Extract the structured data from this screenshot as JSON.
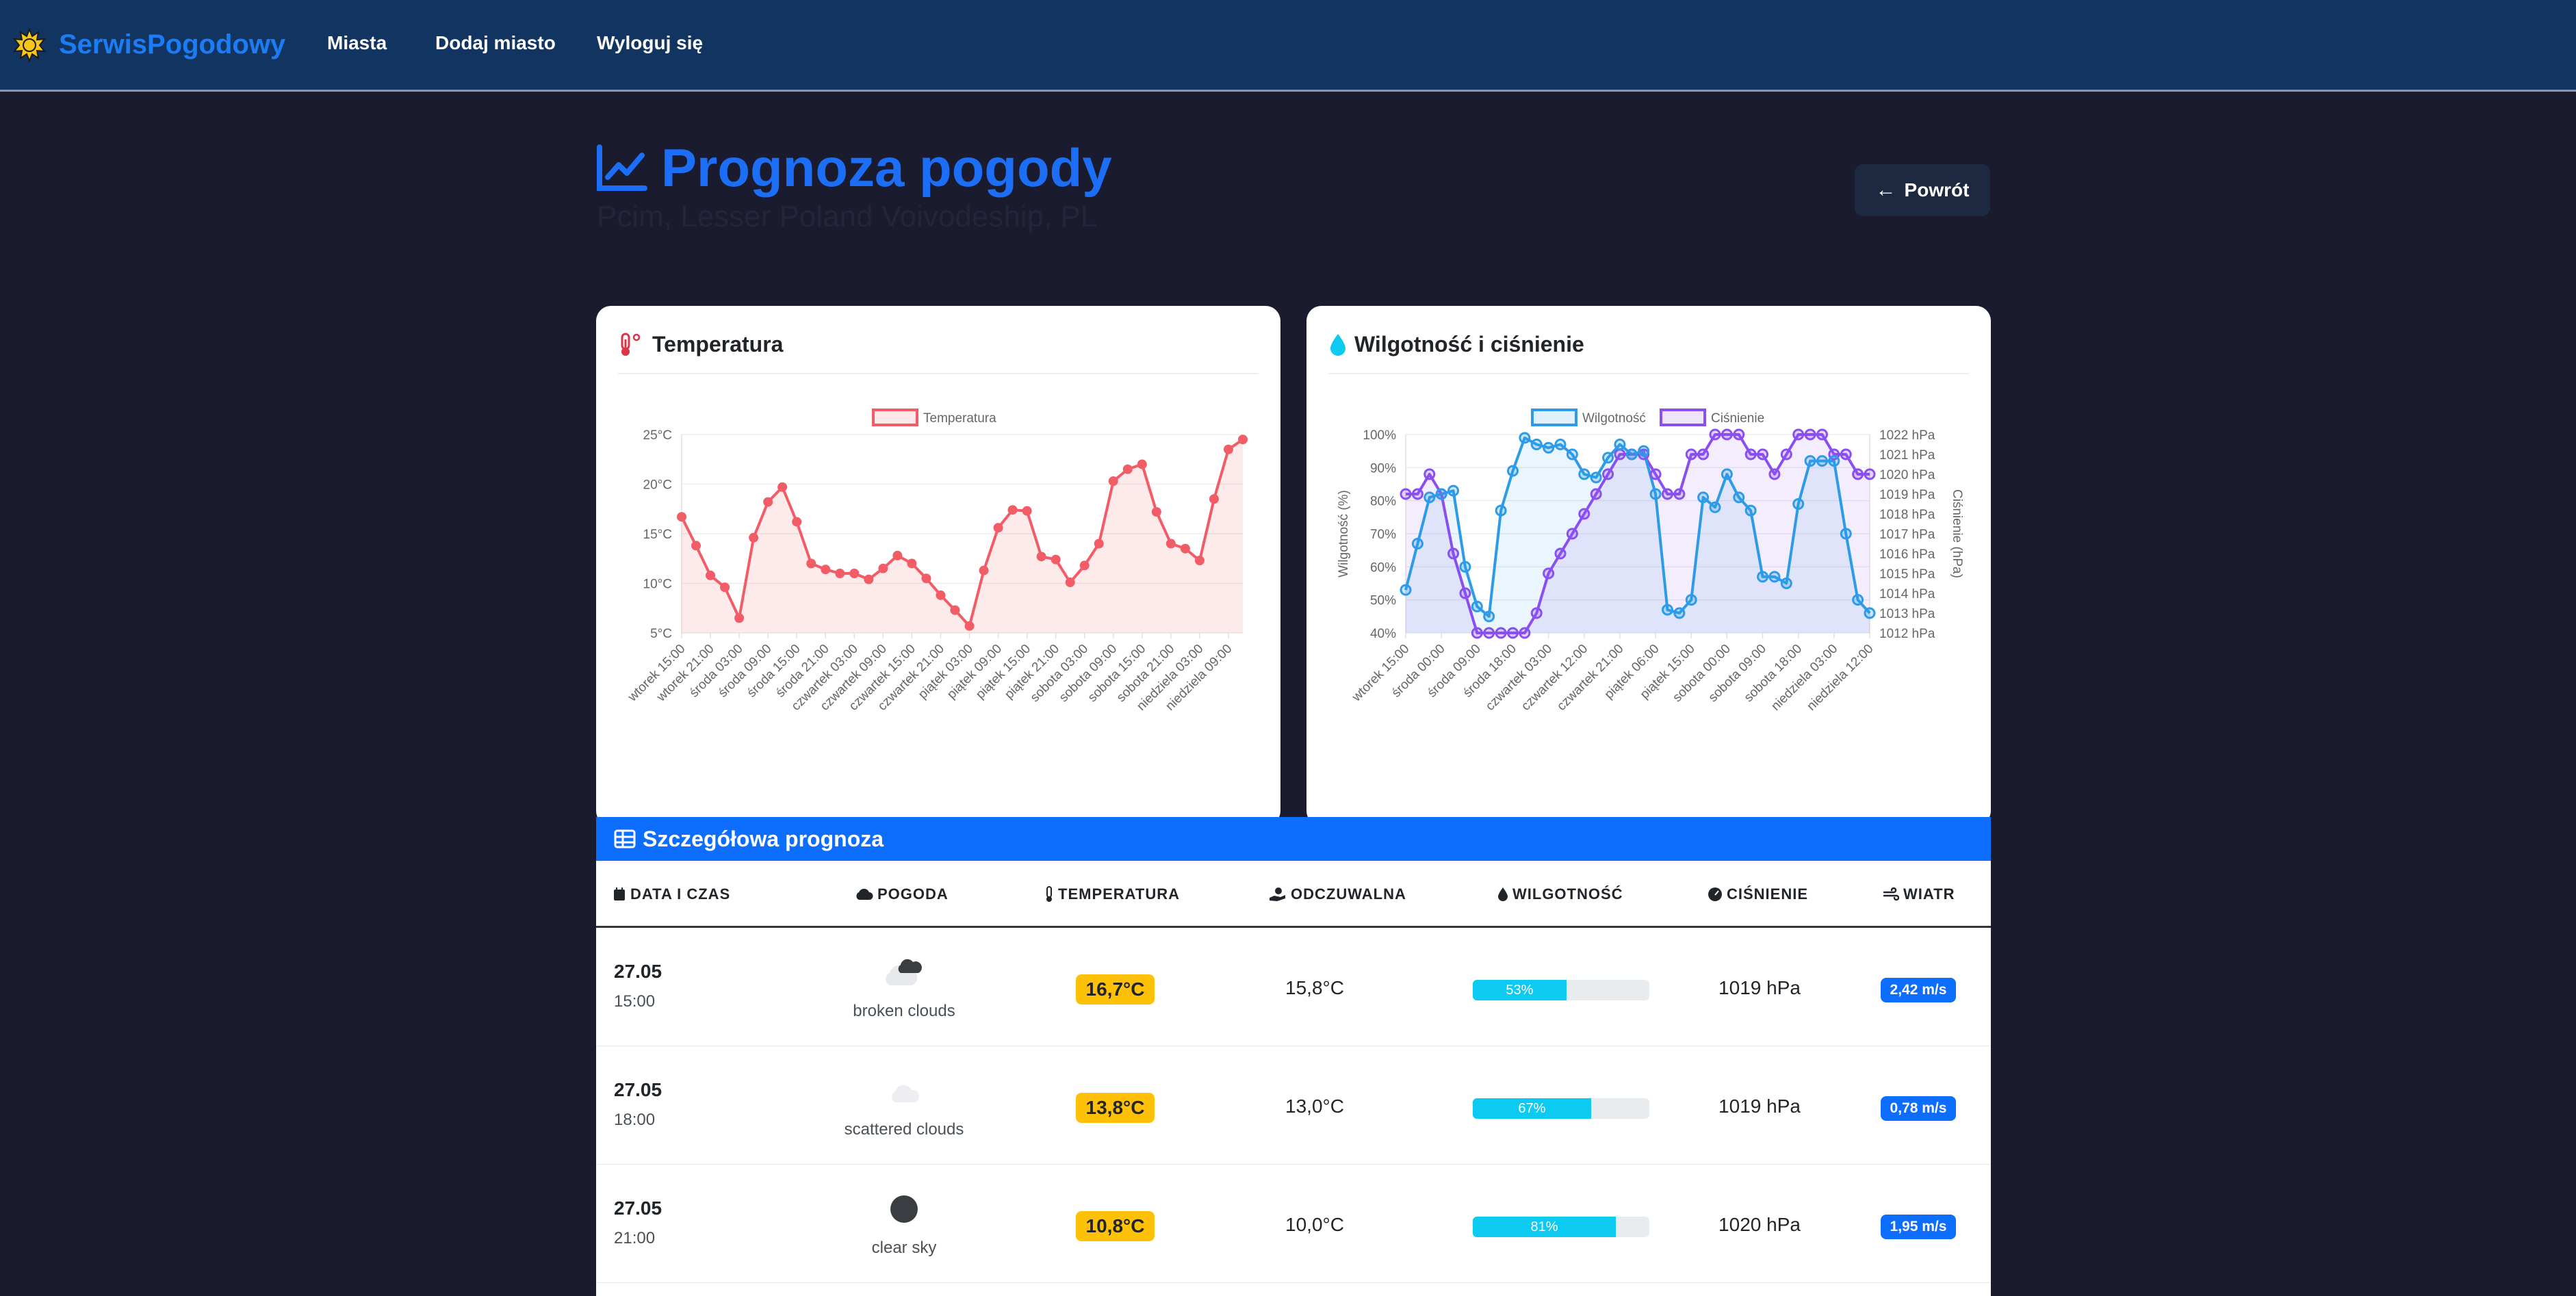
{
  "navbar": {
    "brand": "SerwisPogodowy",
    "links": [
      "Miasta",
      "Dodaj miasto",
      "Wyloguj się"
    ]
  },
  "header": {
    "title": "Prognoza pogody",
    "subtitle": "Pcim, Lesser Poland Voivodeship, PL",
    "back_label": "Powrót"
  },
  "temperature_card": {
    "title": "Temperatura"
  },
  "humidity_card": {
    "title": "Wilgotność i ciśnienie"
  },
  "table": {
    "title": "Szczegółowa prognoza",
    "columns": [
      "DATA I CZAS",
      "POGODA",
      "TEMPERATURA",
      "ODCZUWALNA",
      "WILGOTNOŚĆ",
      "CIŚNIENIE",
      "WIATR"
    ],
    "rows": [
      {
        "date": "27.05",
        "time": "15:00",
        "weather": "broken clouds",
        "icon": "broken-clouds-icon",
        "temp": "16,7°C",
        "feels": "15,8°C",
        "humidity": 53,
        "humidity_label": "53%",
        "pressure": "1019 hPa",
        "wind": "2,42 m/s"
      },
      {
        "date": "27.05",
        "time": "18:00",
        "weather": "scattered clouds",
        "icon": "scattered-clouds-icon",
        "temp": "13,8°C",
        "feels": "13,0°C",
        "humidity": 67,
        "humidity_label": "67%",
        "pressure": "1019 hPa",
        "wind": "0,78 m/s"
      },
      {
        "date": "27.05",
        "time": "21:00",
        "weather": "clear sky",
        "icon": "clear-sky-icon",
        "temp": "10,8°C",
        "feels": "10,0°C",
        "humidity": 81,
        "humidity_label": "81%",
        "pressure": "1020 hPa",
        "wind": "1,95 m/s"
      }
    ]
  },
  "colors": {
    "navbar": "#123461",
    "brand": "#1b7cf5",
    "temp_line": "#f25c66",
    "humidity_line": "#2d9be8",
    "pressure_line": "#8a4ff0",
    "table_header": "#0d6efd",
    "temp_badge": "#ffc107"
  },
  "chart_data": [
    {
      "type": "line",
      "title": "",
      "x": [
        "wtorek 15:00",
        "wtorek 18:00",
        "wtorek 21:00",
        "środa 00:00",
        "środa 03:00",
        "środa 06:00",
        "środa 09:00",
        "środa 12:00",
        "środa 15:00",
        "środa 18:00",
        "środa 21:00",
        "czwartek 00:00",
        "czwartek 03:00",
        "czwartek 06:00",
        "czwartek 09:00",
        "czwartek 12:00",
        "czwartek 15:00",
        "czwartek 18:00",
        "czwartek 21:00",
        "piątek 00:00",
        "piątek 03:00",
        "piątek 06:00",
        "piątek 09:00",
        "piątek 12:00",
        "piątek 15:00",
        "piątek 18:00",
        "piątek 21:00",
        "sobota 00:00",
        "sobota 03:00",
        "sobota 06:00",
        "sobota 09:00",
        "sobota 12:00",
        "sobota 15:00",
        "sobota 18:00",
        "sobota 21:00",
        "niedziela 00:00",
        "niedziela 03:00",
        "niedziela 06:00",
        "niedziela 09:00",
        "niedziela 12:00"
      ],
      "tick_labels": [
        "wtorek 15:00",
        "wtorek 21:00",
        "środa 03:00",
        "środa 09:00",
        "środa 15:00",
        "środa 21:00",
        "czwartek 03:00",
        "czwartek 09:00",
        "czwartek 15:00",
        "czwartek 21:00",
        "piątek 03:00",
        "piątek 09:00",
        "piątek 15:00",
        "piątek 21:00",
        "sobota 03:00",
        "sobota 09:00",
        "sobota 15:00",
        "sobota 21:00",
        "niedziela 03:00",
        "niedziela 09:00"
      ],
      "series": [
        {
          "name": "Temperatura",
          "values": [
            16.7,
            13.8,
            10.8,
            9.6,
            6.5,
            14.6,
            18.2,
            19.7,
            16.2,
            12.0,
            11.4,
            11.0,
            11.0,
            10.4,
            11.5,
            12.8,
            12.0,
            10.5,
            8.8,
            7.3,
            5.7,
            11.3,
            15.6,
            17.4,
            17.3,
            12.7,
            12.4,
            10.1,
            11.8,
            14.0,
            20.3,
            21.5,
            22.0,
            17.2,
            14.0,
            13.5,
            12.3,
            18.5,
            23.5,
            24.5
          ]
        }
      ],
      "ylim": [
        5,
        25
      ],
      "yticks": [
        "5°C",
        "10°C",
        "15°C",
        "20°C",
        "25°C"
      ],
      "legend": "top"
    },
    {
      "type": "line",
      "title": "",
      "ylabel": "Wilgotność (%)",
      "y2label": "Ciśnienie (hPa)",
      "x": [
        "wtorek 15:00",
        "wtorek 18:00",
        "wtorek 21:00",
        "środa 00:00",
        "środa 03:00",
        "środa 06:00",
        "środa 09:00",
        "środa 12:00",
        "środa 15:00",
        "środa 18:00",
        "środa 21:00",
        "czwartek 00:00",
        "czwartek 03:00",
        "czwartek 06:00",
        "czwartek 09:00",
        "czwartek 12:00",
        "czwartek 15:00",
        "czwartek 18:00",
        "czwartek 21:00",
        "piątek 00:00",
        "piątek 03:00",
        "piątek 06:00",
        "piątek 09:00",
        "piątek 12:00",
        "piątek 15:00",
        "piątek 18:00",
        "piątek 21:00",
        "sobota 00:00",
        "sobota 03:00",
        "sobota 06:00",
        "sobota 09:00",
        "sobota 12:00",
        "sobota 15:00",
        "sobota 18:00",
        "sobota 21:00",
        "niedziela 00:00",
        "niedziela 03:00",
        "niedziela 06:00",
        "niedziela 09:00",
        "niedziela 12:00"
      ],
      "tick_labels": [
        "wtorek 15:00",
        "środa 00:00",
        "środa 09:00",
        "środa 18:00",
        "czwartek 03:00",
        "czwartek 12:00",
        "czwartek 21:00",
        "piątek 06:00",
        "piątek 15:00",
        "sobota 00:00",
        "sobota 09:00",
        "sobota 18:00",
        "niedziela 03:00",
        "niedziela 12:00"
      ],
      "series": [
        {
          "name": "Wilgotność",
          "axis": "left",
          "values": [
            53,
            67,
            81,
            82,
            83,
            60,
            48,
            45,
            77,
            89,
            99,
            97,
            96,
            97,
            94,
            88,
            87,
            93,
            97,
            94,
            95,
            82,
            47,
            46,
            50,
            81,
            78,
            88,
            81,
            77,
            57,
            57,
            55,
            79,
            92,
            92,
            92,
            70,
            50,
            46
          ]
        },
        {
          "name": "Ciśnienie",
          "axis": "right",
          "values": [
            1019,
            1019,
            1020,
            1019,
            1016,
            1014,
            1012,
            1012,
            1012,
            1012,
            1012,
            1013,
            1015,
            1016,
            1017,
            1018,
            1019,
            1020,
            1021,
            1021,
            1021,
            1020,
            1019,
            1019,
            1021,
            1021,
            1022,
            1022,
            1022,
            1021,
            1021,
            1020,
            1021,
            1022,
            1022,
            1022,
            1021,
            1021,
            1020,
            1020
          ]
        }
      ],
      "ylim": [
        40,
        100
      ],
      "y2lim": [
        1012,
        1022
      ],
      "yticks": [
        "40%",
        "50%",
        "60%",
        "70%",
        "80%",
        "90%",
        "100%"
      ],
      "y2ticks": [
        "1012 hPa",
        "1013 hPa",
        "1014 hPa",
        "1015 hPa",
        "1016 hPa",
        "1017 hPa",
        "1018 hPa",
        "1019 hPa",
        "1020 hPa",
        "1021 hPa",
        "1022 hPa"
      ],
      "legend": "top"
    }
  ]
}
